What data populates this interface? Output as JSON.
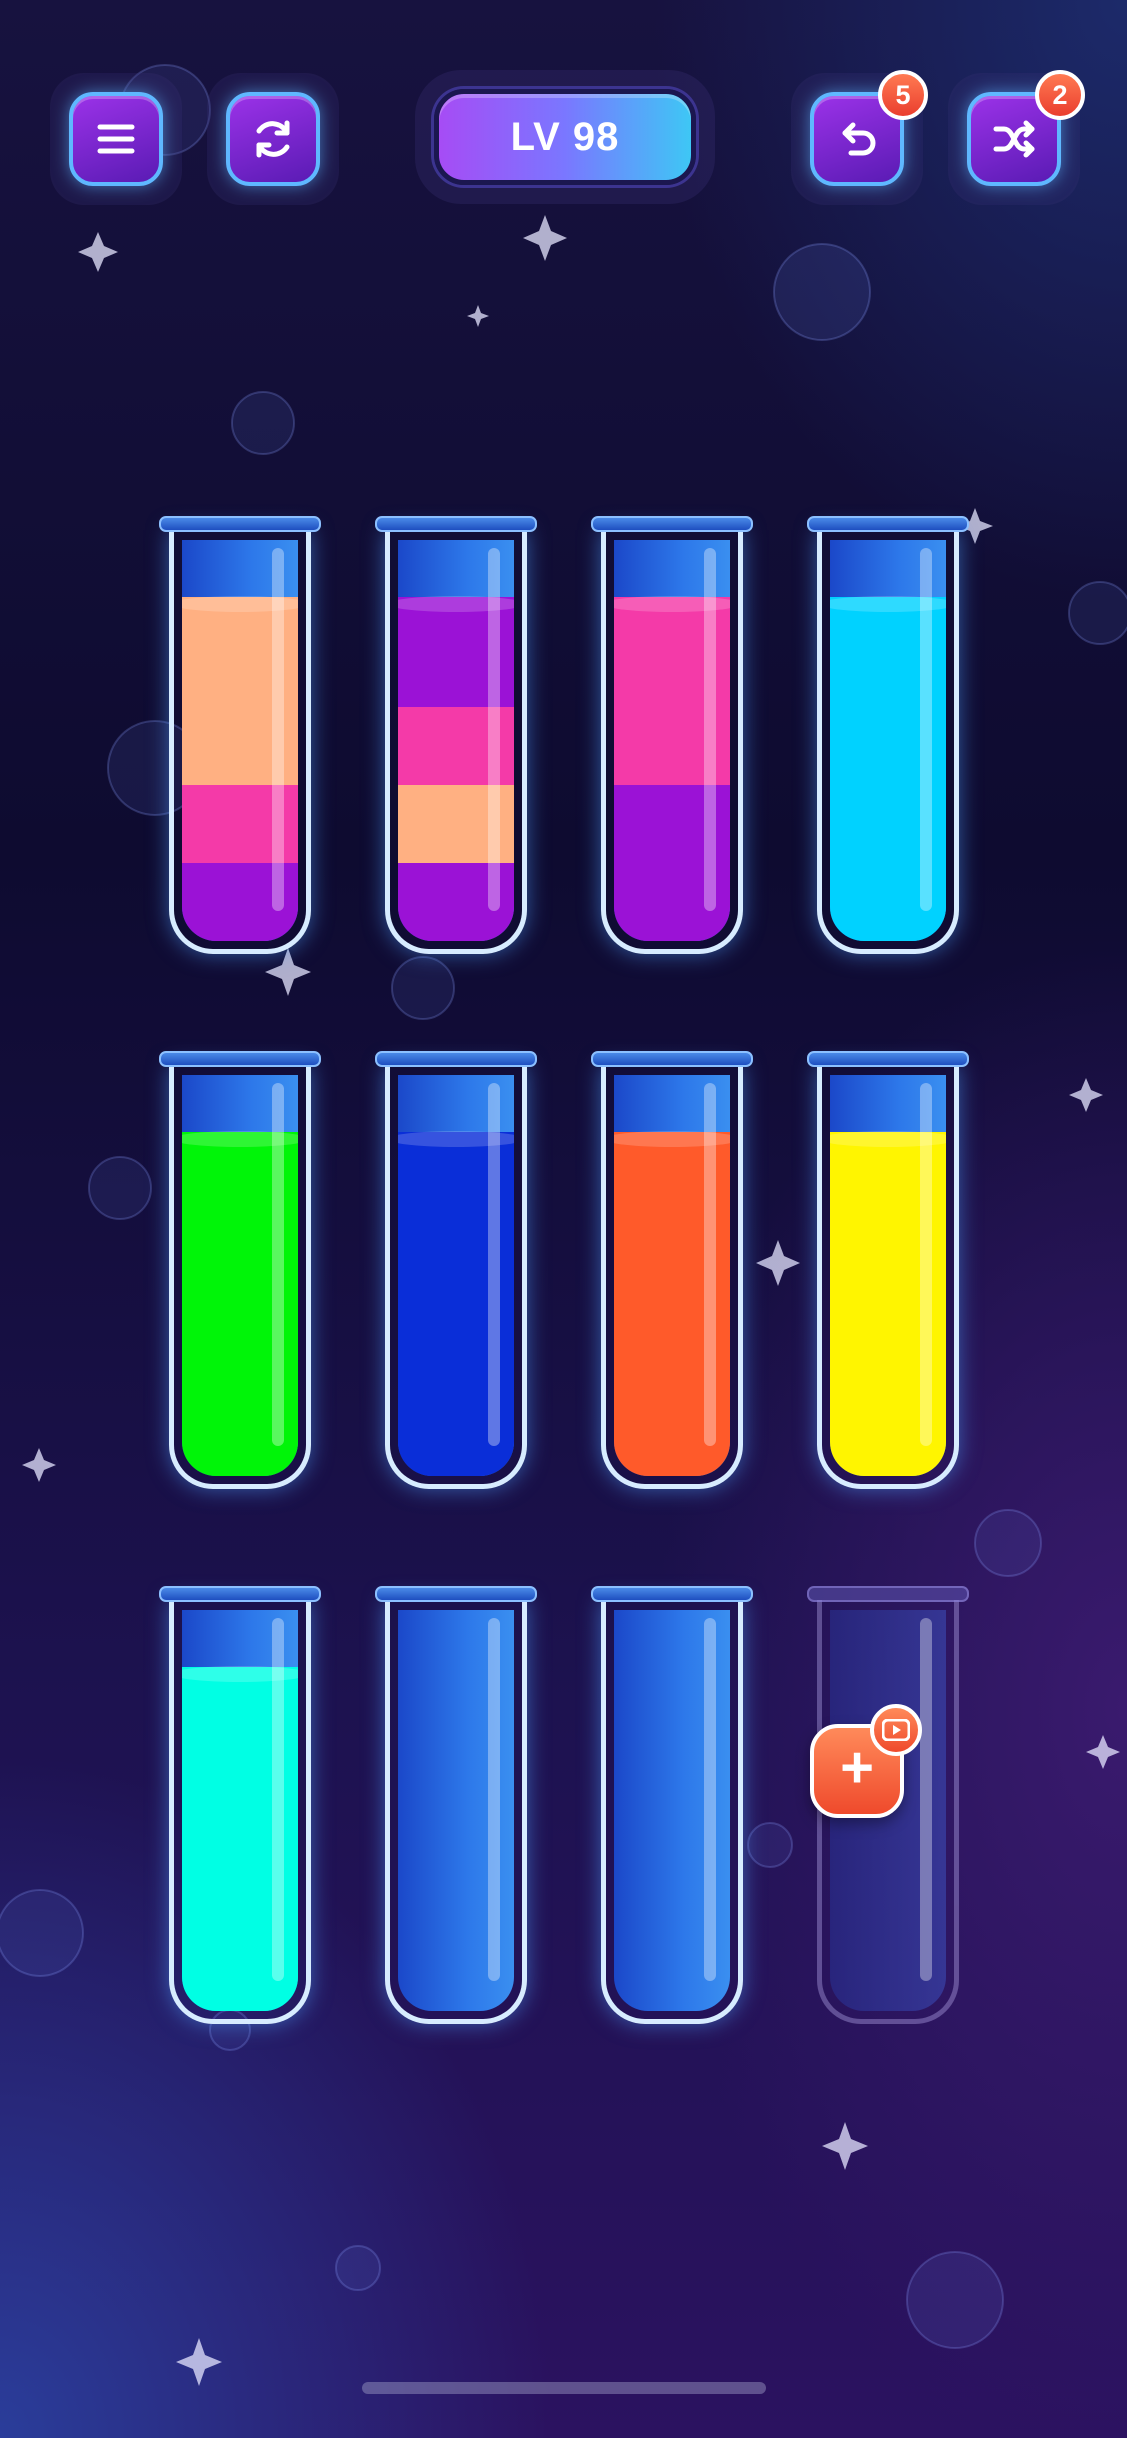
{
  "hud": {
    "level_label": "LV 98",
    "undo_count": "5",
    "shuffle_count": "2",
    "icons": {
      "menu": "menu-icon",
      "restart": "restart-icon",
      "undo": "undo-icon",
      "shuffle": "shuffle-icon"
    }
  },
  "tubes": [
    {
      "layers": [
        "#9b12d6",
        "#f43aa8",
        "#ffb082"
      ],
      "locked": false
    },
    {
      "layers": [
        "#9b12d6",
        "#ffb082",
        "#f43aa8",
        "#9b12d6"
      ],
      "locked": false
    },
    {
      "layers": [
        "#9b12d6",
        "#9b12d6",
        "#f43aa8",
        "#f43aa8"
      ],
      "locked": false
    },
    {
      "layers": [
        "#00d2ff",
        "#00d2ff",
        "#00d2ff",
        "#00d2ff"
      ],
      "locked": false
    },
    {
      "layers": [
        "#00f508",
        "#00f508",
        "#00f508",
        "#00f508"
      ],
      "locked": false
    },
    {
      "layers": [
        "#0a2ed8",
        "#0a2ed8",
        "#0a2ed8",
        "#0a2ed8"
      ],
      "locked": false
    },
    {
      "layers": [
        "#ff5a2a",
        "#ff5a2a",
        "#ff5a2a",
        "#ff5a2a"
      ],
      "locked": false
    },
    {
      "layers": [
        "#fff500",
        "#fff500",
        "#fff500",
        "#fff500"
      ],
      "locked": false
    },
    {
      "layers": [
        "#00ffe4",
        "#00ffe4",
        "#00ffe4",
        "#00ffe4"
      ],
      "locked": false
    },
    {
      "layers": [],
      "locked": false
    },
    {
      "layers": [],
      "locked": false
    },
    {
      "layers": [],
      "locked": true
    }
  ],
  "tube_capacity": 4,
  "add_tube": {
    "icon": "plus-icon",
    "badge_icon": "video-ad-icon"
  }
}
